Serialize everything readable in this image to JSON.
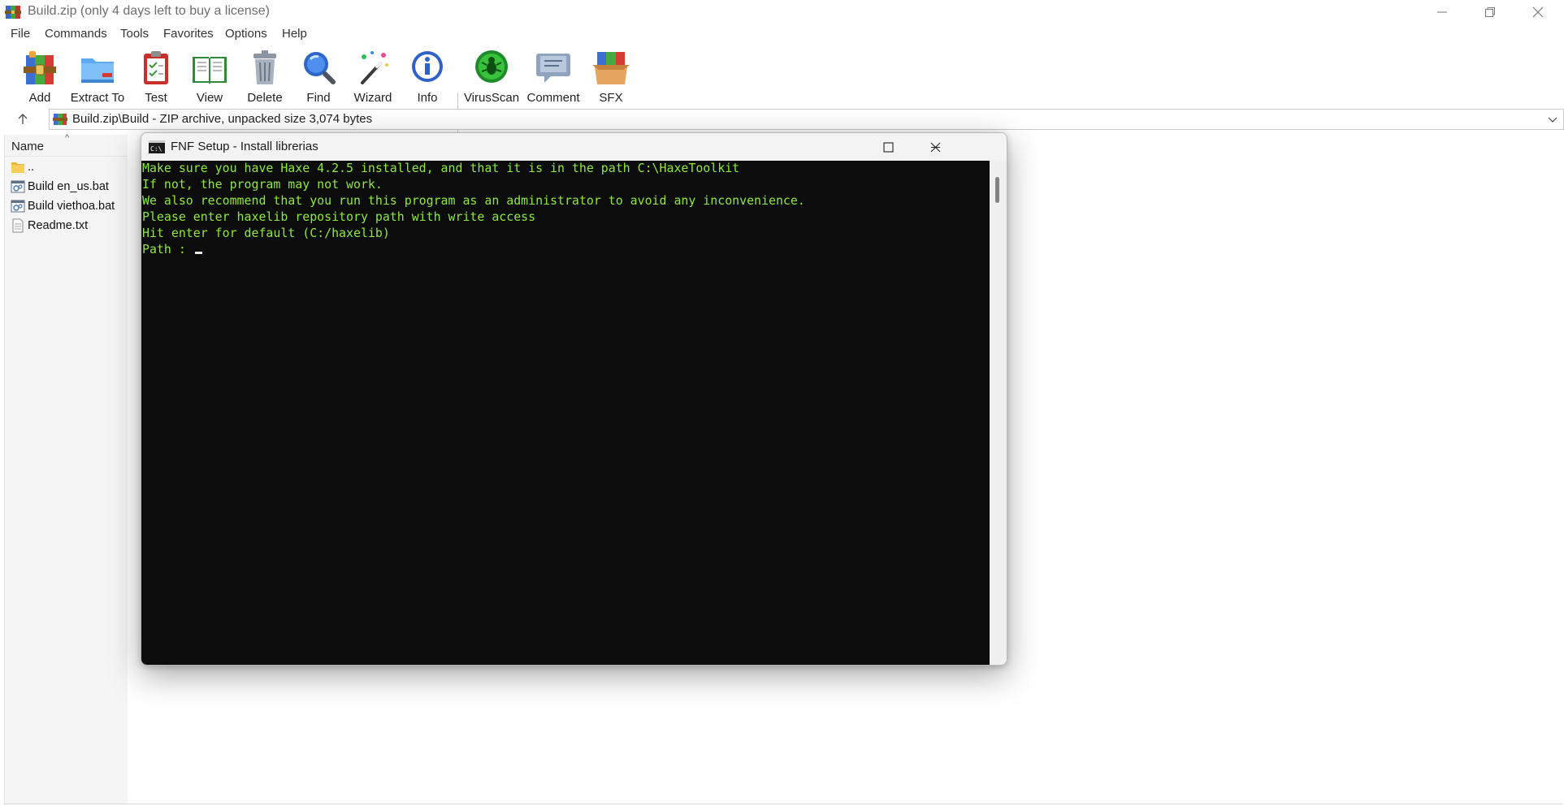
{
  "window": {
    "title": "Build.zip (only 4 days left to buy a license)"
  },
  "menu": [
    "File",
    "Commands",
    "Tools",
    "Favorites",
    "Options",
    "Help"
  ],
  "toolbar": {
    "buttons": [
      {
        "label": "Add",
        "icon": "add-archive-icon"
      },
      {
        "label": "Extract To",
        "icon": "extract-folder-icon"
      },
      {
        "label": "Test",
        "icon": "test-clipboard-icon"
      },
      {
        "label": "View",
        "icon": "view-book-icon"
      },
      {
        "label": "Delete",
        "icon": "trash-icon"
      },
      {
        "label": "Find",
        "icon": "magnifier-icon"
      },
      {
        "label": "Wizard",
        "icon": "wizard-wand-icon"
      },
      {
        "label": "Info",
        "icon": "info-icon"
      },
      {
        "label": "VirusScan",
        "icon": "virus-scan-icon"
      },
      {
        "label": "Comment",
        "icon": "comment-icon"
      },
      {
        "label": "SFX",
        "icon": "sfx-box-icon"
      }
    ]
  },
  "address": {
    "path": "Build.zip\\Build - ZIP archive, unpacked size 3,074 bytes"
  },
  "files": {
    "column_name": "Name",
    "items": [
      {
        "name": "..",
        "icon": "folder-icon"
      },
      {
        "name": "Build en_us.bat",
        "icon": "batch-file-icon"
      },
      {
        "name": "Build viethoa.bat",
        "icon": "batch-file-icon"
      },
      {
        "name": "Readme.txt",
        "icon": "text-file-icon"
      }
    ]
  },
  "console": {
    "title": "FNF Setup - Install librerias",
    "lines": [
      "Make sure you have Haxe 4.2.5 installed, and that it is in the path C:\\HaxeToolkit",
      "If not, the program may not work.",
      "We also recommend that you run this program as an administrator to avoid any inconvenience.",
      "Please enter haxelib repository path with write access",
      "Hit enter for default (C:/haxelib)",
      "Path : "
    ],
    "text_color": "#8ee83c",
    "background": "#0c0c0c"
  },
  "colors": {
    "accent_winrar_red": "#b3262c",
    "console_green": "#8ee83c"
  }
}
